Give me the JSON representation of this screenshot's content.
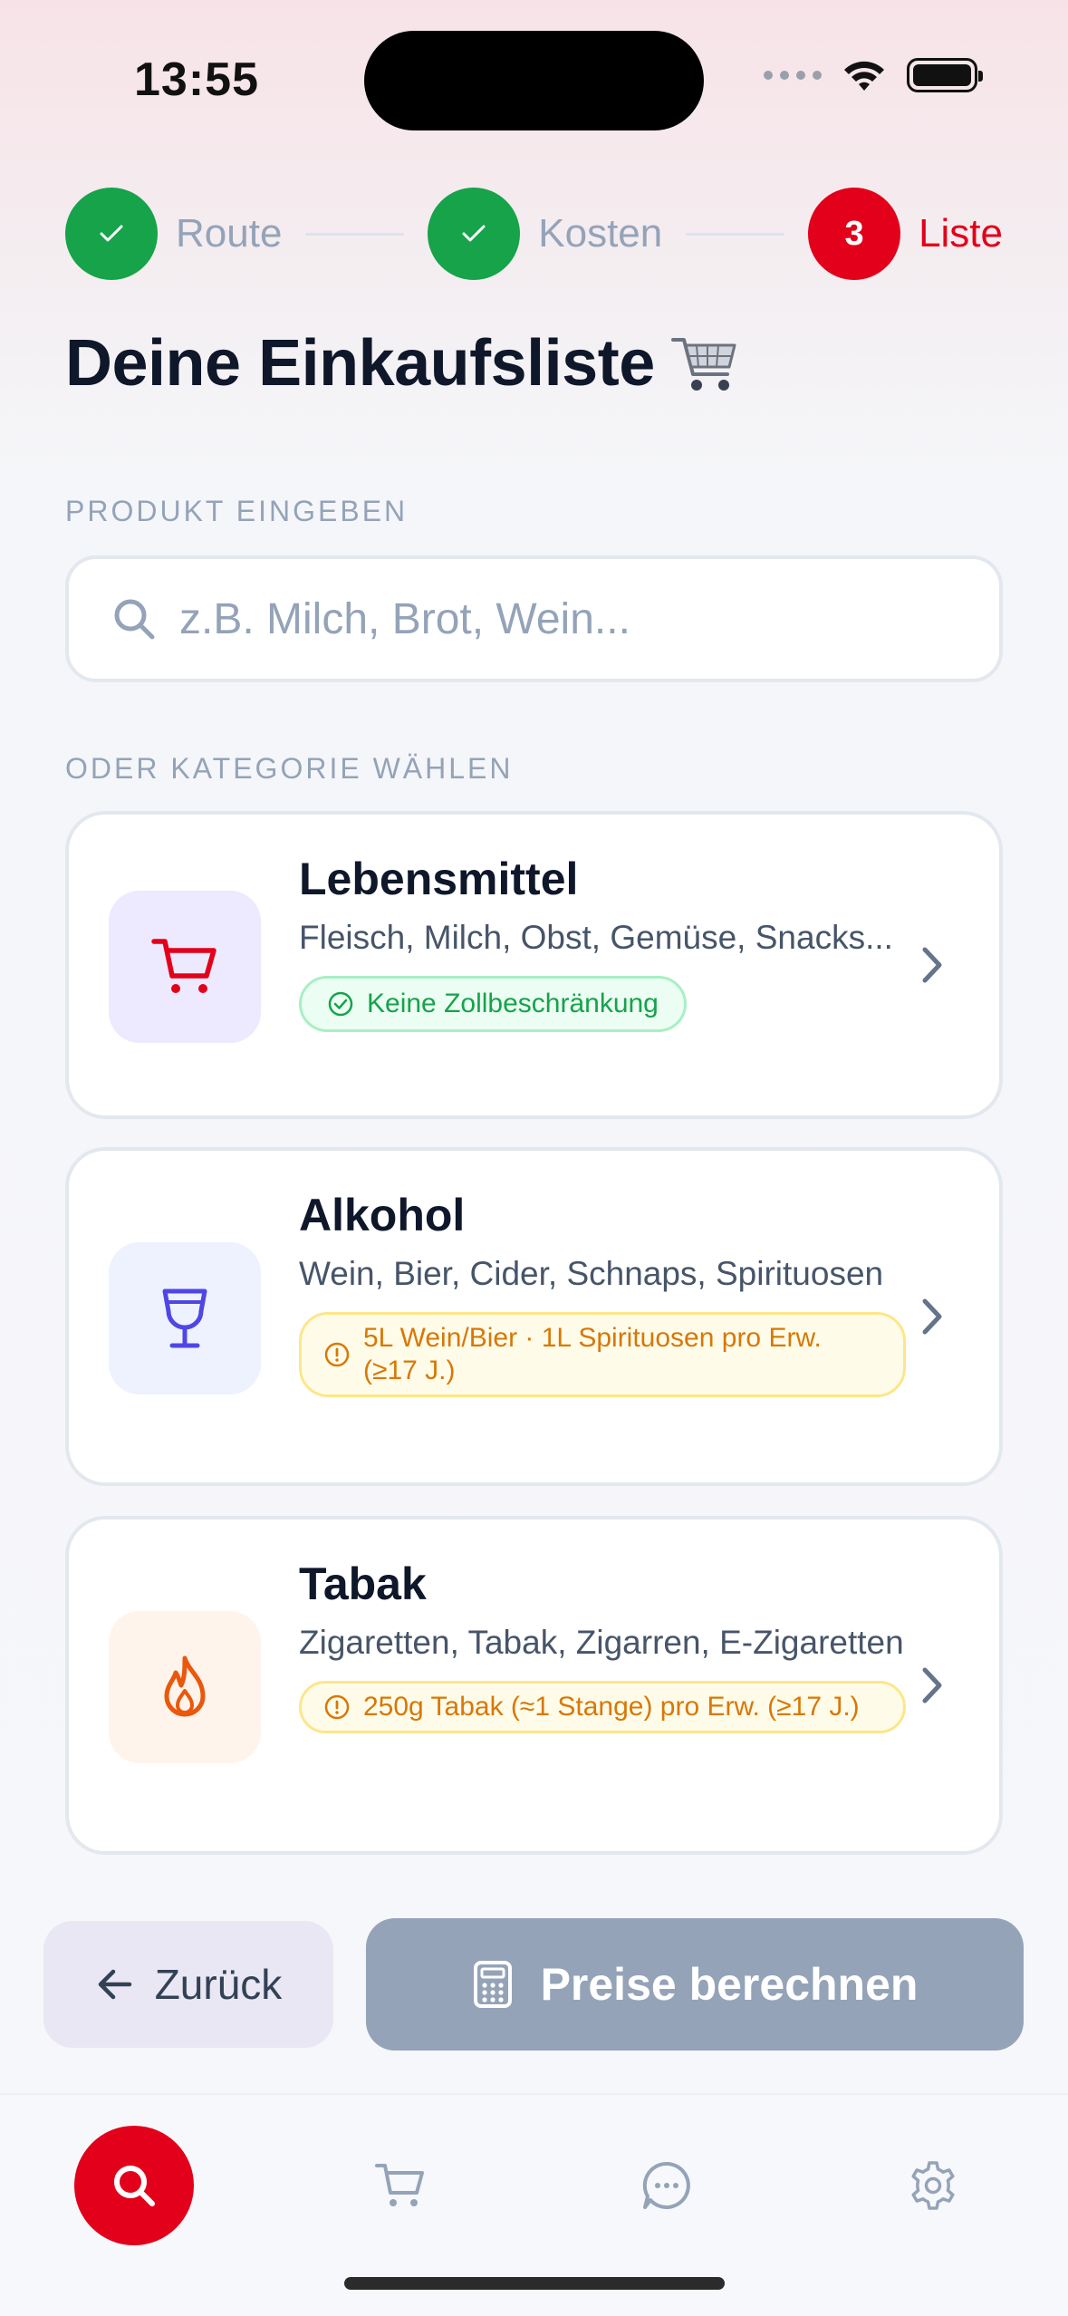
{
  "status_bar": {
    "time": "13:55"
  },
  "stepper": {
    "steps": [
      {
        "label": "Route",
        "state": "done"
      },
      {
        "label": "Kosten",
        "state": "done"
      },
      {
        "label": "Liste",
        "state": "active",
        "number": "3"
      }
    ]
  },
  "page": {
    "title": "Deine Einkaufsliste"
  },
  "search": {
    "section_label": "PRODUKT EINGEBEN",
    "placeholder": "z.B. Milch, Brot, Wein...",
    "value": ""
  },
  "categories": {
    "section_label": "ODER KATEGORIE WÄHLEN",
    "items": [
      {
        "title": "Lebensmittel",
        "description": "Fleisch, Milch, Obst, Gemüse, Snacks...",
        "badge": "Keine Zollbeschränkung",
        "badge_type": "success",
        "icon": "cart-icon",
        "icon_color": "#e2001a"
      },
      {
        "title": "Alkohol",
        "description": "Wein, Bier, Cider, Schnaps, Spirituosen",
        "badge": "5L Wein/Bier · 1L Spirituosen pro Erw. (≥17 J.)",
        "badge_type": "warning",
        "icon": "wine-glass-icon",
        "icon_color": "#4f46e5"
      },
      {
        "title": "Tabak",
        "description": "Zigaretten, Tabak, Zigarren, E-Zigaretten",
        "badge": "250g Tabak (≈1 Stange) pro Erw. (≥17 J.)",
        "badge_type": "warning",
        "icon": "flame-icon",
        "icon_color": "#ea580c"
      }
    ]
  },
  "actions": {
    "back_label": "Zurück",
    "calculate_label": "Preise berechnen"
  },
  "tab_bar": {
    "items": [
      {
        "icon": "search-icon",
        "active": true
      },
      {
        "icon": "cart-icon",
        "active": false
      },
      {
        "icon": "chat-icon",
        "active": false
      },
      {
        "icon": "gear-icon",
        "active": false
      }
    ]
  },
  "colors": {
    "brand": "#e2001a",
    "success": "#16a34a",
    "warning": "#d97706",
    "disabled": "#94a3b8"
  }
}
